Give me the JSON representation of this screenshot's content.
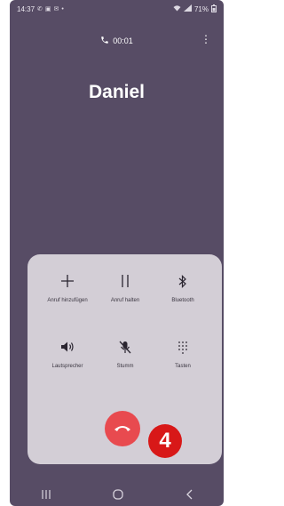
{
  "status_bar": {
    "time": "14:37",
    "left_icons": [
      "phone-icon",
      "gallery-icon",
      "mail-icon",
      "dot-icon"
    ],
    "battery": "71%"
  },
  "call": {
    "timer": "00:01",
    "caller_name": "Daniel"
  },
  "controls": [
    {
      "label": "Anruf hinzufügen",
      "icon": "plus-icon"
    },
    {
      "label": "Anruf halten",
      "icon": "pause-icon"
    },
    {
      "label": "Bluetooth",
      "icon": "bluetooth-icon"
    },
    {
      "label": "Lautsprecher",
      "icon": "speaker-icon"
    },
    {
      "label": "Stumm",
      "icon": "mic-muted-icon"
    },
    {
      "label": "Tasten",
      "icon": "keypad-icon"
    }
  ],
  "annotation": {
    "badge": "4"
  },
  "colors": {
    "background": "#574c65",
    "panel": "#d3ced6",
    "end_call": "#e84a4f",
    "badge": "#d81818"
  },
  "nav": [
    "recent-apps-icon",
    "home-icon",
    "back-icon"
  ]
}
